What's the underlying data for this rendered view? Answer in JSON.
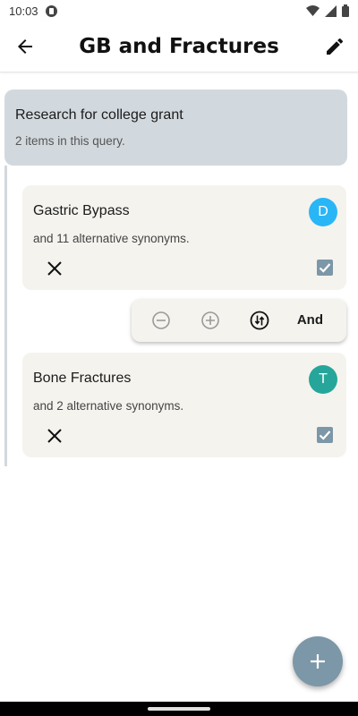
{
  "status": {
    "time": "10:03"
  },
  "toolbar": {
    "title": "GB and Fractures",
    "back_icon": "arrow-back-icon",
    "edit_icon": "pencil-icon"
  },
  "query": {
    "title": "Research for college grant",
    "count_text": "2 items in this query."
  },
  "terms": [
    {
      "title": "Gastric Bypass",
      "subtitle": "and 11 alternative synonyms.",
      "avatar_letter": "D",
      "avatar_color": "#29b6f6",
      "checked": true
    },
    {
      "title": "Bone Fractures",
      "subtitle": "and 2 alternative synonyms.",
      "avatar_letter": "T",
      "avatar_color": "#26a69a",
      "checked": true
    }
  ],
  "operator": {
    "label": "And",
    "icons": [
      "minus-circle-icon",
      "plus-circle-icon",
      "swap-icon"
    ]
  },
  "fab": {
    "icon": "plus-icon"
  },
  "colors": {
    "accent": "#7c97a7",
    "header_bg": "#d2d9de",
    "card_bg": "#f4f3ee"
  }
}
